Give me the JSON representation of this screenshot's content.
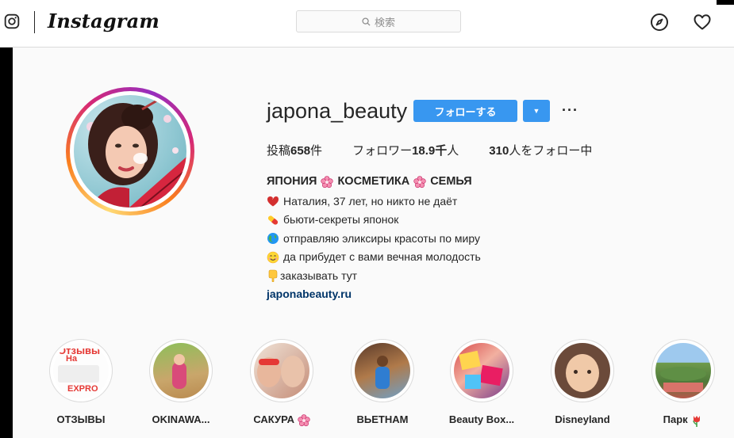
{
  "nav": {
    "logo": "Instagram",
    "search_placeholder": "検索",
    "icons": [
      "instagram-glyph-icon",
      "explore-compass-icon",
      "activity-heart-icon"
    ]
  },
  "profile": {
    "username": "japona_beauty",
    "follow_label": "フォローする",
    "dropdown_icon": "▼",
    "more_label": "···",
    "stats": {
      "posts_prefix": "投稿",
      "posts_count": "658",
      "posts_suffix": "件",
      "followers_prefix": "フォロワー",
      "followers_count": "18.9千",
      "followers_suffix": "人",
      "following_count": "310",
      "following_suffix": "人をフォロー中"
    },
    "bio": {
      "title_part1": "ЯПОНИЯ",
      "title_part2": "КОСМЕТИКА",
      "title_part3": "СЕМЬЯ",
      "line1": "Наталия, 37 лет, но никто не даёт",
      "line2": "бьюти-секреты японок",
      "line3": "отправляю эликсиры красоты по миру",
      "line4": "да прибудет с вами вечная молодость",
      "line5": "заказывать тут",
      "link": "japonabeauty.ru"
    }
  },
  "stories": [
    {
      "label": "ОТЗЫВЫ",
      "thumb_text1": "Отзывы",
      "thumb_text2": "На",
      "thumb_text3": "EXPRO"
    },
    {
      "label": "OKINAWA..."
    },
    {
      "label": "САКУРА"
    },
    {
      "label": "ВЬЕТНАМ"
    },
    {
      "label": "Beauty Box..."
    },
    {
      "label": "Disneyland"
    },
    {
      "label": "Парк"
    }
  ],
  "colors": {
    "accent": "#3897f0",
    "link": "#003569",
    "border": "#dbdbdb",
    "text": "#262626"
  }
}
